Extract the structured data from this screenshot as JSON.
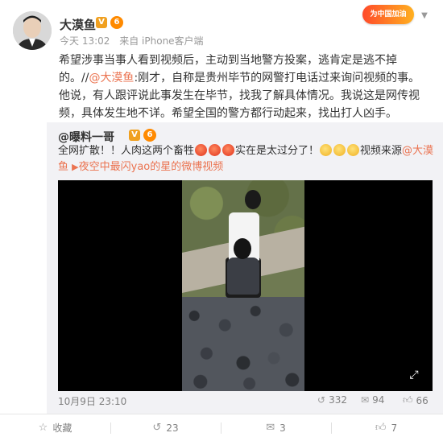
{
  "post": {
    "author": "大漠鱼",
    "v_badge": "V",
    "vip_badge": "6",
    "time": "今天 13:02",
    "source": "来自 iPhone客户端",
    "event_badge": "为中国加油",
    "content_part1": "希望涉事当事人看到视频后，主动到当地警方投案，逃肯定是逃不掉的。//",
    "mention": "@大漠鱼",
    "content_part2": ":刚才，自称是贵州毕节的网警打电话过来询问视频的事。他说，有人跟评说此事发生在毕节，找我了解具体情况。我说这是网传视频，具体发生地不详。希望全国的警方都行动起来，找出打人凶手。"
  },
  "repost": {
    "author": "@曝料一哥",
    "v_badge": "V",
    "vip_badge": "6",
    "text_part1": "全网扩散！！人肉这两个畜牲",
    "text_part2": "实在是太过分了！",
    "text_part3": "视频来源",
    "mention": "@大漠鱼",
    "video_label": "夜空中最闪yao的星的微博视频",
    "time": "10月9日 23:10",
    "reposts": "332",
    "comments": "94",
    "likes": "66"
  },
  "actions": {
    "favorite": "收藏",
    "forward": "23",
    "comment": "3",
    "like": "7"
  },
  "icons": {
    "repost": "repost-icon",
    "comment": "comment-icon",
    "like": "thumbs-up-icon",
    "favorite": "star-icon",
    "video": "video-play-icon"
  },
  "colors": {
    "link": "#eb7350",
    "repost_bg": "#f2f2f5",
    "meta_text": "#999999"
  }
}
